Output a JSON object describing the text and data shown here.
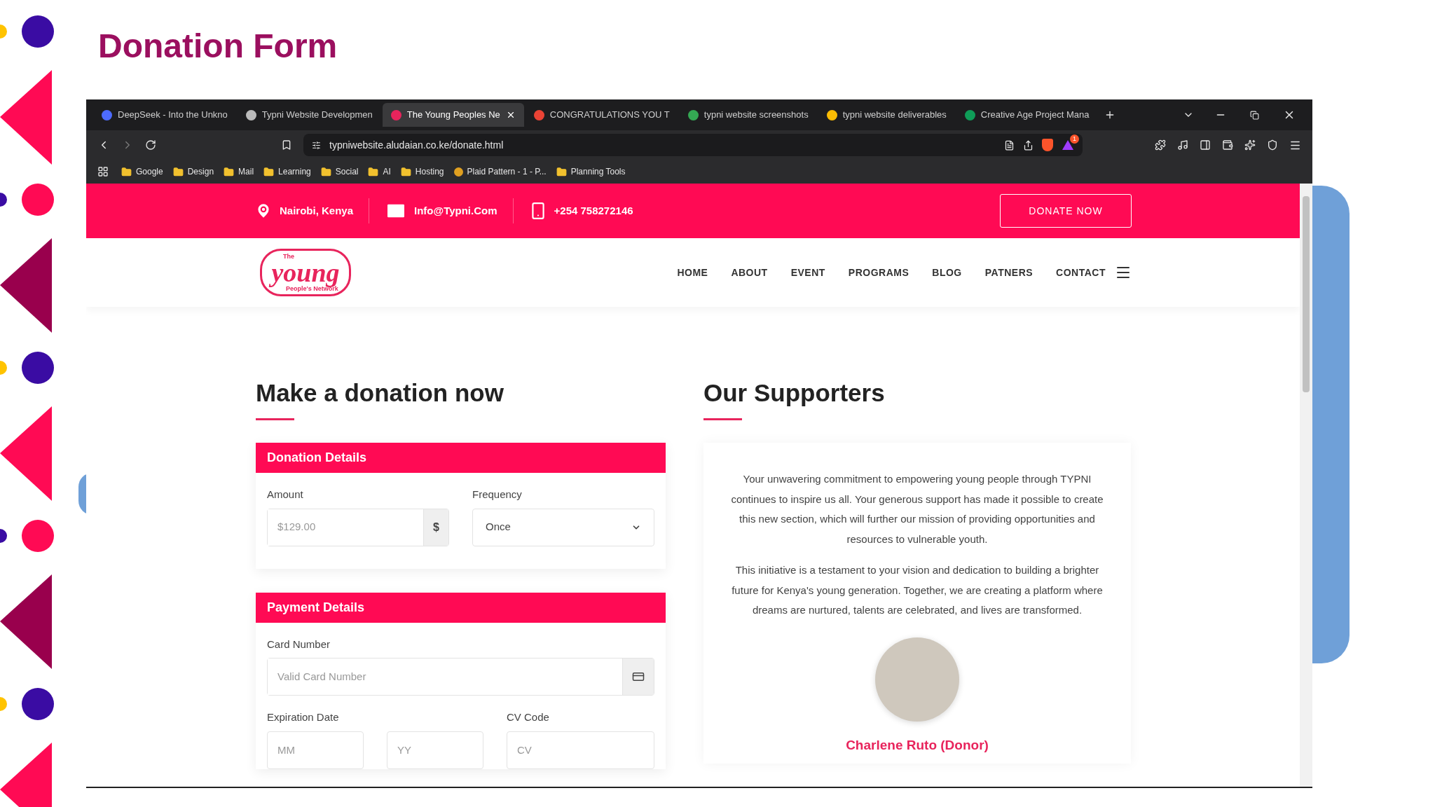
{
  "slide_title": "Donation Form",
  "tabs": [
    {
      "label": "DeepSeek - Into the Unkno",
      "selected": false,
      "color": "#4d6bfe"
    },
    {
      "label": "Typni Website Developmen",
      "selected": false,
      "color": "#bbbbbb"
    },
    {
      "label": "The Young Peoples Ne",
      "selected": true,
      "color": "#e8245c"
    },
    {
      "label": "CONGRATULATIONS YOU T",
      "selected": false,
      "color": "#ea4335"
    },
    {
      "label": "typni website screenshots",
      "selected": false,
      "color": "#34a853"
    },
    {
      "label": "typni website deliverables",
      "selected": false,
      "color": "#fbbc04"
    },
    {
      "label": "Creative Age Project Mana",
      "selected": false,
      "color": "#0f9d58"
    }
  ],
  "address_bar": {
    "url": "typniwebsite.aludaian.co.ke/donate.html",
    "notification_count": "1"
  },
  "bookmarks": [
    {
      "label": "Google",
      "kind": "folder"
    },
    {
      "label": "Design",
      "kind": "folder"
    },
    {
      "label": "Mail",
      "kind": "folder"
    },
    {
      "label": "Learning",
      "kind": "folder"
    },
    {
      "label": "Social",
      "kind": "folder"
    },
    {
      "label": "AI",
      "kind": "folder"
    },
    {
      "label": "Hosting",
      "kind": "folder"
    },
    {
      "label": "Plaid Pattern - 1 - P...",
      "kind": "site"
    },
    {
      "label": "Planning Tools",
      "kind": "folder"
    }
  ],
  "top_bar": {
    "location": "Nairobi, Kenya",
    "email": "Info@Typni.Com",
    "phone": "+254 758272146",
    "donate_button": "DONATE NOW"
  },
  "logo": {
    "small_top": "The",
    "word": "young",
    "tagline": "People's Network"
  },
  "nav": [
    "HOME",
    "ABOUT",
    "EVENT",
    "PROGRAMS",
    "BLOG",
    "PATNERS",
    "CONTACT"
  ],
  "donation": {
    "heading": "Make a donation now",
    "details_title": "Donation Details",
    "amount_label": "Amount",
    "amount_placeholder": "$129.00",
    "currency": "$",
    "frequency_label": "Frequency",
    "frequency_value": "Once",
    "payment_title": "Payment Details",
    "card_label": "Card Number",
    "card_placeholder": "Valid Card Number",
    "expiry_label": "Expiration Date",
    "month_placeholder": "MM",
    "year_placeholder": "YY",
    "cv_label": "CV Code",
    "cv_placeholder": "CV"
  },
  "supporters": {
    "heading": "Our Supporters",
    "paragraphs": [
      "Your unwavering commitment to empowering young people through TYPNI continues to inspire us all. Your generous support has made it possible to create this new section, which will further our mission of providing opportunities and resources to vulnerable youth.",
      "This initiative is a testament to your vision and dedication to building a brighter future for Kenya's young generation. Together, we are creating a platform where dreams are nurtured, talents are celebrated, and lives are transformed."
    ],
    "donor_name": "Charlene Ruto (Donor)"
  }
}
